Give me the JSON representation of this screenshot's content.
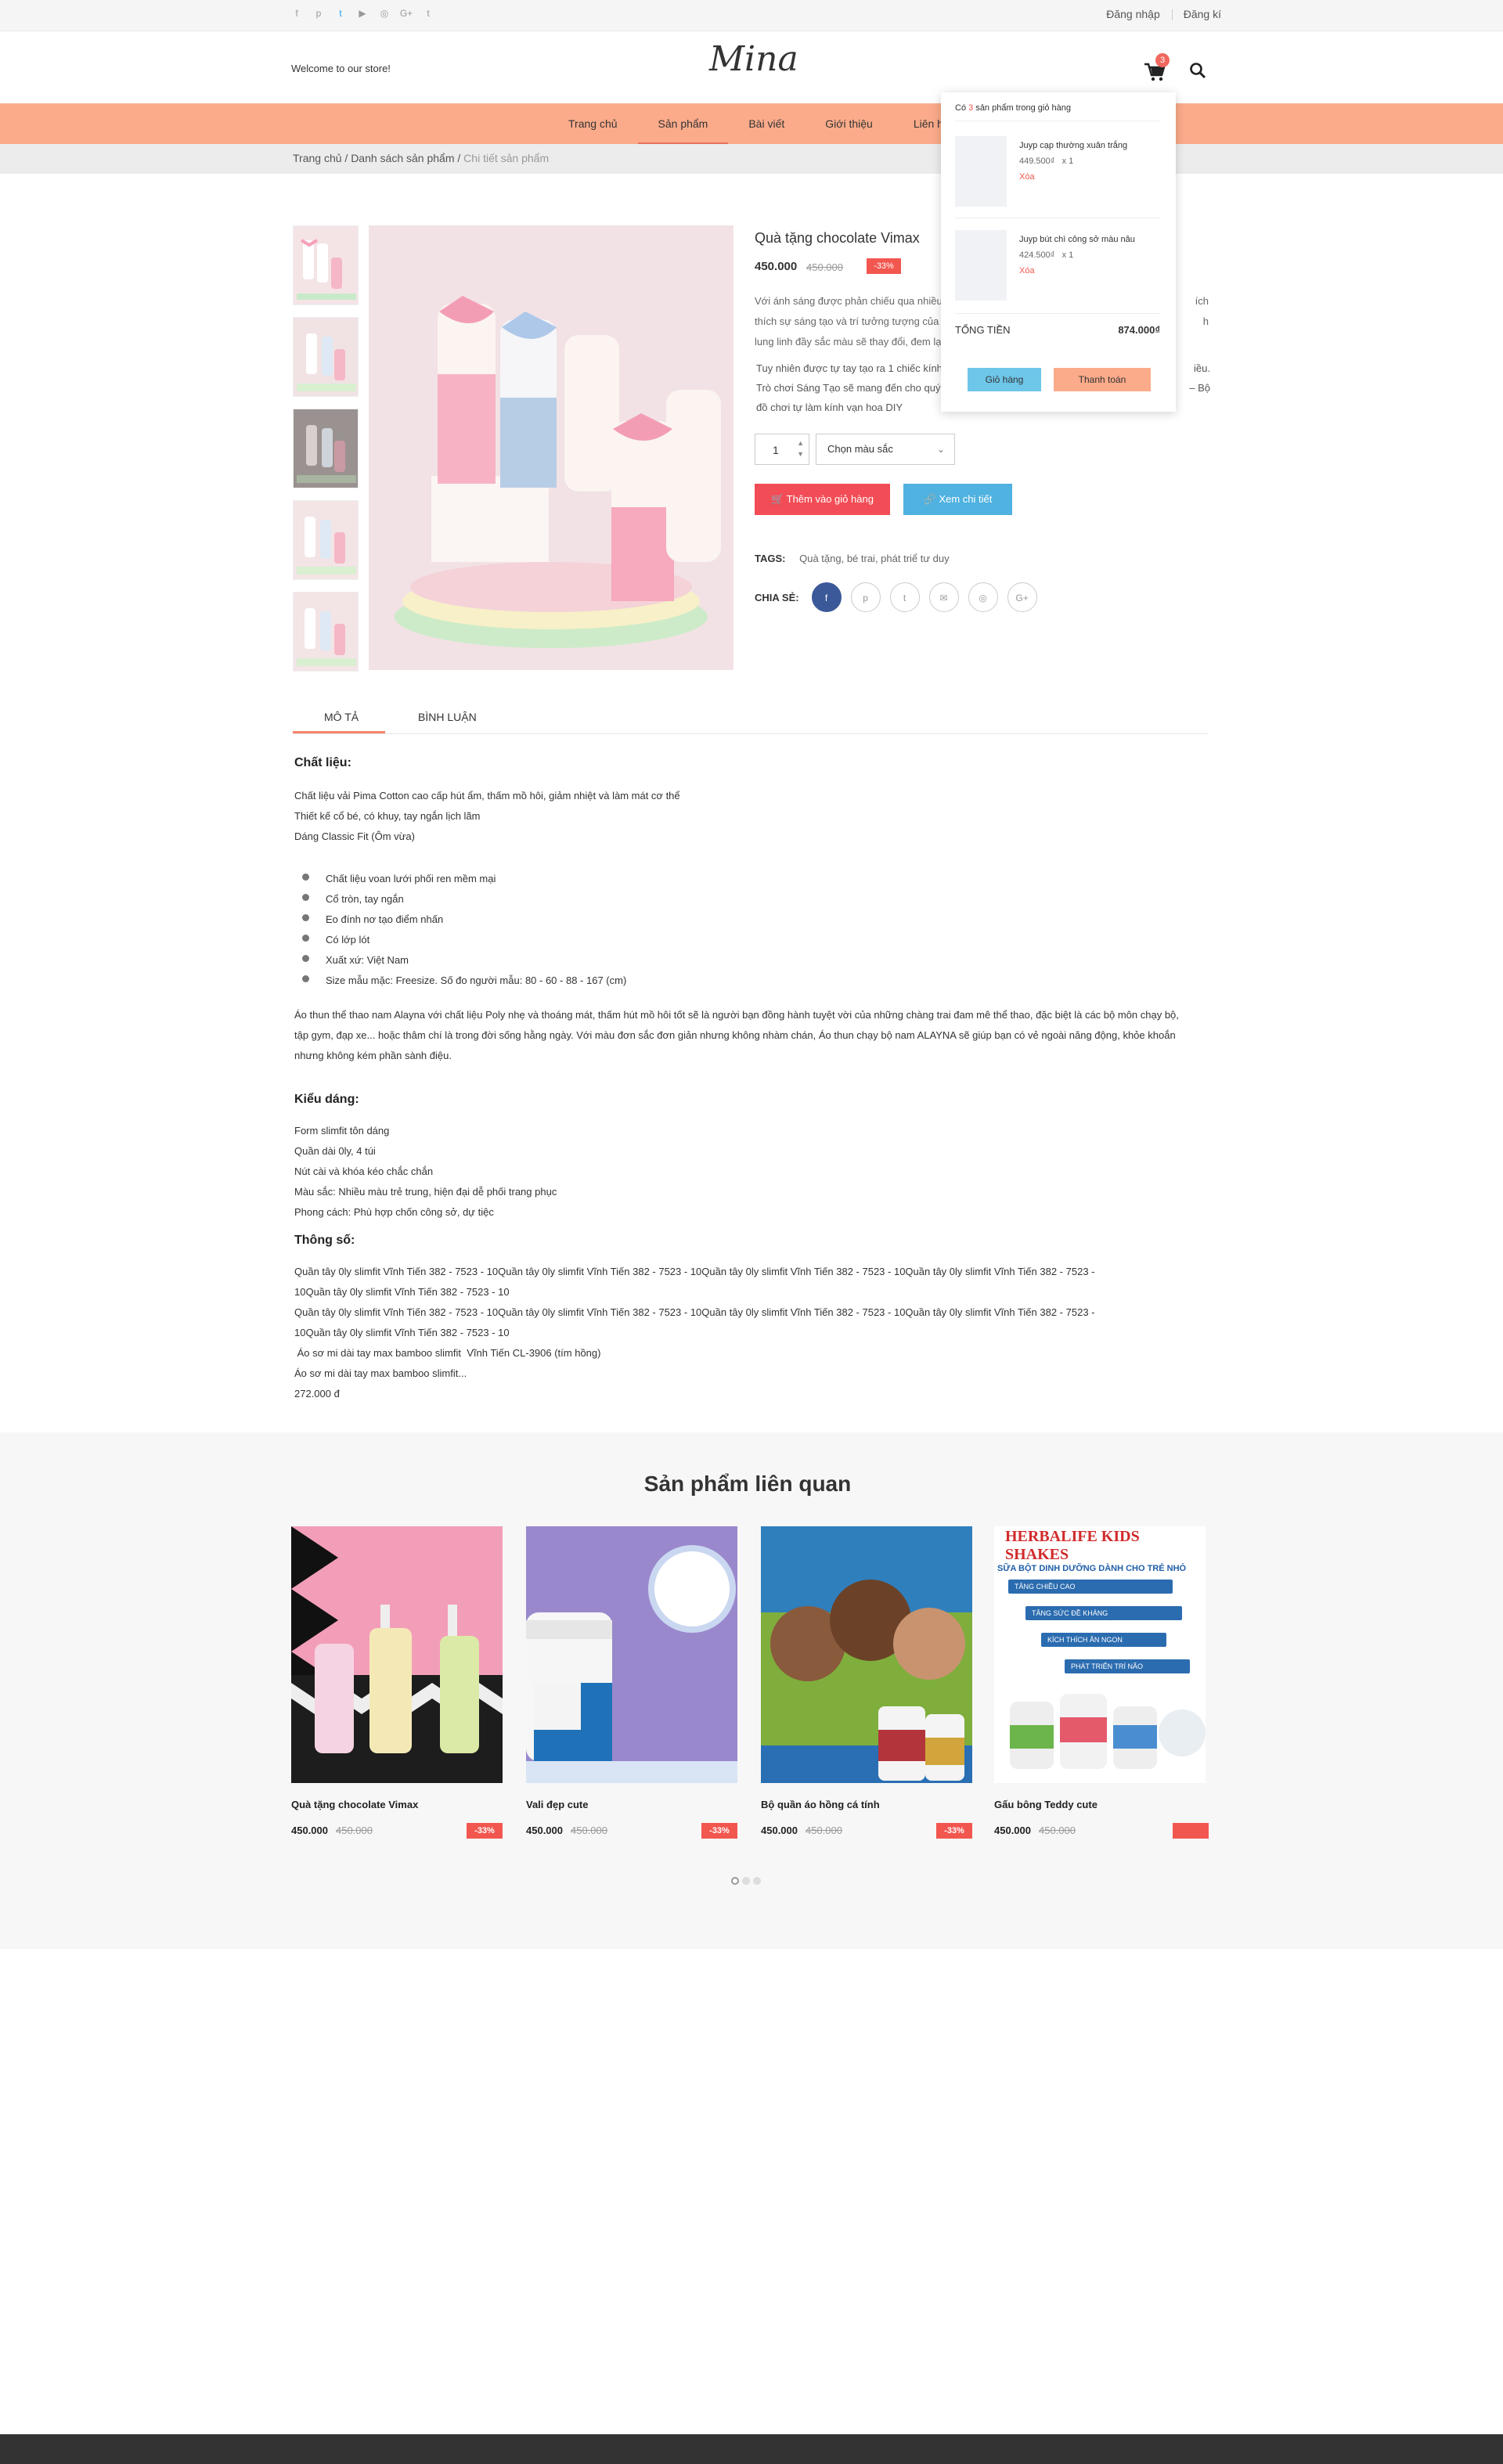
{
  "topbar": {
    "social": [
      "f",
      "p",
      "t",
      "▶",
      "◎",
      "G+",
      "t"
    ],
    "login": "Đăng nhập",
    "register": "Đăng kí"
  },
  "header": {
    "welcome": "Welcome to our store!",
    "logo": "Mina",
    "cart_count": "3"
  },
  "nav": [
    "Trang chủ",
    "Sản phẩm",
    "Bài viết",
    "Giới thiệu",
    "Liên hệ"
  ],
  "breadcrumb": {
    "home": "Trang chủ",
    "list": "Danh sách sản phẩm",
    "current": "Chi tiết sản phẩm",
    "sep": "/"
  },
  "product": {
    "title": "Quà tặng chocolate Vimax",
    "price": "450.000",
    "old_price": "450.000",
    "discount": "-33%",
    "desc_line1": "Với ánh sáng được phản chiếu qua nhiều",
    "desc_line1_end": "ích",
    "desc_line2": "thích sự sáng tạo và trí tưởng tượng của t",
    "desc_line2_end": "h",
    "desc_line3": "lung linh đầy sắc màu sẽ thay đổi, đem lạ",
    "desc2_line1": "Tuy nhiên được tự tay tạo ra 1 chiếc kính",
    "desc2_line1_end": "iều.",
    "desc2_line2": "Trò chơi Sáng Tạo sẽ mang đến cho quý p",
    "desc2_line2_end": "– Bộ",
    "desc2_line3": "đồ chơi tự làm kính vạn hoa DIY",
    "qty": "1",
    "color_select": "Chọn màu sắc",
    "add_to_cart": "Thêm vào giỏ hàng",
    "view_detail": "Xem chi tiết",
    "tags_label": "TAGS:",
    "tags": "Quà tặng, bé trai, phát triể tư duy",
    "share_label": "CHIA SẺ:",
    "share_icons": [
      "f",
      "p",
      "t",
      "✉",
      "◎",
      "G+"
    ]
  },
  "tabs": {
    "desc": "MÔ TẢ",
    "comments": "BÌNH LUẬN"
  },
  "description": {
    "material_title": "Chất liệu:",
    "material_lines": [
      "Chất liệu vải Pima Cotton cao cấp hút ẩm, thấm mồ hôi, giảm nhiệt và làm mát cơ thể",
      "Thiết kế cổ bé, có khuy, tay ngắn lịch lãm",
      "Dáng Classic Fit (Ôm vừa)"
    ],
    "bullets": [
      "Chất liệu voan lưới phối ren mềm mại",
      "Cổ tròn, tay ngắn",
      "Eo đính nơ tạo điểm nhấn",
      "Có lớp lót",
      "Xuất xứ: Việt Nam",
      "Size mẫu mặc: Freesize. Số đo người mẫu: 80 - 60 - 88 - 167 (cm)"
    ],
    "paragraph": "Áo thun thể thao nam Alayna với chất liệu Poly nhẹ và thoáng mát, thấm hút mồ hôi tốt sẽ là người bạn đồng hành tuyệt vời của những chàng trai đam mê thể thao, đặc biệt là các bộ môn chạy bộ, tập gym, đạp xe... hoặc thâm chí là trong đời sống hằng ngày. Với màu đơn sắc đơn giản nhưng không nhàm chán, Áo thun chạy bộ nam ALAYNA sẽ giúp bạn có vẻ ngoài năng động, khỏe khoắn nhưng không kém phần sành điệu.",
    "style_title": "Kiểu dáng:",
    "style_lines": [
      "Form slimfit tôn dáng",
      "Quần dài 0ly, 4 túi",
      "Nút cài và khóa kéo chắc chắn",
      "Màu sắc: Nhiều màu trẻ trung, hiện đại dễ phối trang phục",
      "Phong cách: Phù hợp chốn công sở, dự tiệc"
    ],
    "specs_title": "Thông số:",
    "specs_lines": [
      "Quần tây 0ly slimfit Vĩnh Tiến 382 - 7523 - 10Quần tây 0ly slimfit Vĩnh Tiến 382 - 7523 - 10Quần tây 0ly slimfit Vĩnh Tiến 382 - 7523 - 10Quần tây 0ly slimfit Vĩnh Tiến 382 - 7523 -",
      "10Quần tây 0ly slimfit Vĩnh Tiến 382 - 7523 - 10",
      "Quần tây 0ly slimfit Vĩnh Tiến 382 - 7523 - 10Quần tây 0ly slimfit Vĩnh Tiến 382 - 7523 - 10Quần tây 0ly slimfit Vĩnh Tiến 382 - 7523 - 10Quần tây 0ly slimfit Vĩnh Tiến 382 - 7523 -",
      "10Quần tây 0ly slimfit Vĩnh Tiến 382 - 7523 - 10",
      " Áo sơ mi dài tay max bamboo slimfit  Vĩnh Tiến CL-3906 (tím hồng)",
      "Áo sơ mi dài tay max bamboo slimfit...",
      "272.000 đ"
    ]
  },
  "related": {
    "title": "Sản phẩm liên quan",
    "items": [
      {
        "name": "Quà tặng chocolate Vimax",
        "price": "450.000",
        "old": "450.000",
        "disc": "-33%"
      },
      {
        "name": "Vali đẹp cute",
        "price": "450.000",
        "old": "450.000",
        "disc": "-33%"
      },
      {
        "name": "Bộ quần áo hồng cá tính",
        "price": "450.000",
        "old": "450.000",
        "disc": "-33%"
      },
      {
        "name": "Gấu bông Teddy cute",
        "price": "450.000",
        "old": "450.000",
        "disc": ""
      }
    ],
    "banner_title": "HERBALIFE KIDS SHAKES",
    "banner_sub": "SỮA BỘT DINH DƯỠNG DÀNH CHO TRẺ NHỎ",
    "banner_points": [
      "TĂNG CHIỀU CAO",
      "TĂNG SỨC ĐỀ KHÁNG",
      "KÍCH THÍCH ĂN NGON",
      "PHÁT TRIỂN TRÍ NÃO"
    ]
  },
  "minicart": {
    "head_pre": "Có",
    "count": "3",
    "head_post": "sản phẩm trong giỏ hàng",
    "items": [
      {
        "name": "Juyp cạp thường xuân trắng",
        "price": "449.500₫",
        "qty": "x   1",
        "del": "Xóa"
      },
      {
        "name": "Juyp bút chì công sở màu nâu",
        "price": "424.500₫",
        "qty": "x   1",
        "del": "Xóa"
      }
    ],
    "total_label": "TỔNG TIỀN",
    "total": "874.000₫",
    "cart_btn": "Giỏ hàng",
    "checkout_btn": "Thanh toán"
  },
  "colors": {
    "accent": "#fbab8a",
    "sale": "#f2574f",
    "blue": "#4fb2e0"
  }
}
